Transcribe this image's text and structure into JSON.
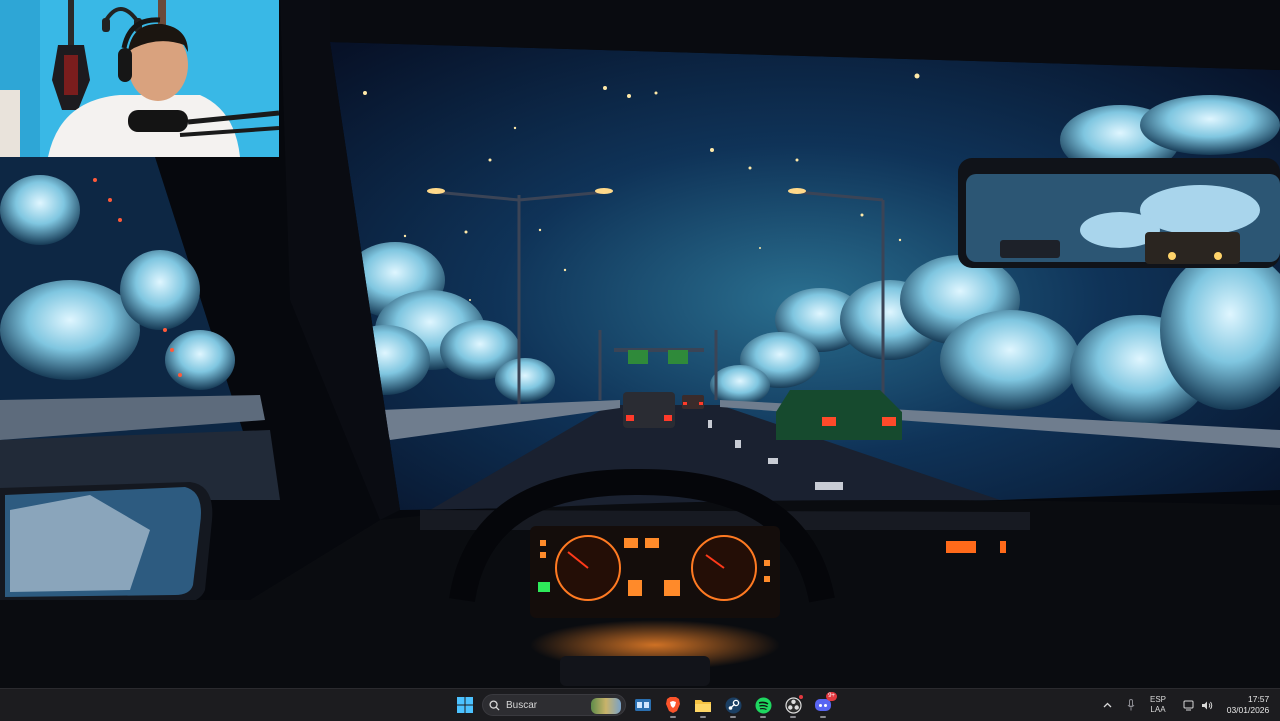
{
  "taskbar": {
    "search_placeholder": "Buscar",
    "apps": [
      {
        "name": "Windows Start",
        "icon": "windows-logo-icon"
      },
      {
        "name": "Task View",
        "icon": "task-view-icon"
      },
      {
        "name": "Brave",
        "icon": "brave-browser-icon"
      },
      {
        "name": "File Explorer",
        "icon": "folder-icon"
      },
      {
        "name": "Steam",
        "icon": "steam-icon"
      },
      {
        "name": "Spotify",
        "icon": "spotify-icon"
      },
      {
        "name": "OBS",
        "icon": "obs-icon"
      },
      {
        "name": "Discord",
        "icon": "discord-icon"
      }
    ],
    "discord_badge": "9+",
    "tray": {
      "language_line1": "ESP",
      "language_line2": "LAA",
      "time": "17:57",
      "date": "03/01/2026"
    }
  },
  "colors": {
    "taskbar_bg": "#1c1c1f",
    "webcam_wall": "#39b8e6",
    "sky": "#0b1f3f",
    "dash_glow": "#ff6a1a"
  }
}
